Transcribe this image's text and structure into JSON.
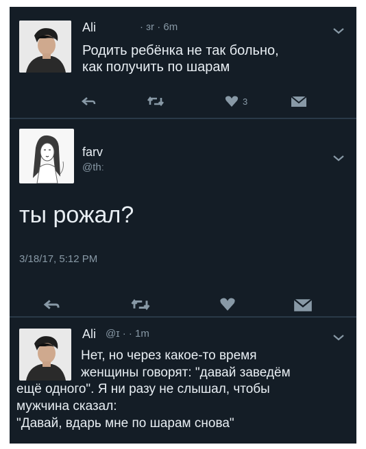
{
  "tweets": [
    {
      "name": "Ali",
      "meta": "· ɜr · 6m",
      "text": "Родить ребёнка не так больно,\nкак получить по шарам",
      "likes": "3"
    },
    {
      "name": "farv",
      "handle": "@thː",
      "text": "ты рожал?",
      "timestamp": "3/18/17, 5:12 PM"
    },
    {
      "name": "Ali",
      "meta": "@ɪ · · 1m",
      "text": "Нет, но через какое-то время\nженщины говорят: \"давай заведём\nещё одного\". Я ни разу не слышал, чтобы\nмужчина сказал:\n\"Давай, вдарь мне по шарам снова\""
    }
  ],
  "colors": {
    "background": "#141d26",
    "text": "#e8eef3",
    "muted": "#8899a6",
    "separator": "#2a3a48"
  },
  "icons": [
    "reply-icon",
    "retweet-icon",
    "like-icon",
    "dm-icon",
    "chevron-down-icon"
  ]
}
